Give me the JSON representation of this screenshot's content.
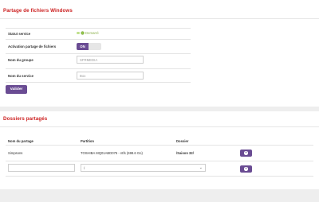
{
  "share": {
    "title": "Partage de fichiers Windows",
    "status_label": "Statut service",
    "status_value": "Demarré",
    "activation_label": "Activation partage de fichiers",
    "toggle_on": "ON",
    "group_label": "Nom du groupe",
    "group_placeholder": "SFRMEDIA",
    "service_label": "Nom du service",
    "service_placeholder": "Box",
    "submit_label": "Valider"
  },
  "folders": {
    "title": "Dossiers partagés",
    "columns": [
      "Nom du partage",
      "Partition",
      "Dossier"
    ],
    "rows": [
      {
        "name": "Simpsons",
        "partition": "TOSHIBA MQ01ABD075 - ntfs (698.6 Go)",
        "folder": "/Saison 32/"
      }
    ],
    "new_partition_value": "/"
  },
  "colors": {
    "accent": "#6a4c93",
    "title": "#cc1f1f",
    "status": "#8ab04a"
  }
}
